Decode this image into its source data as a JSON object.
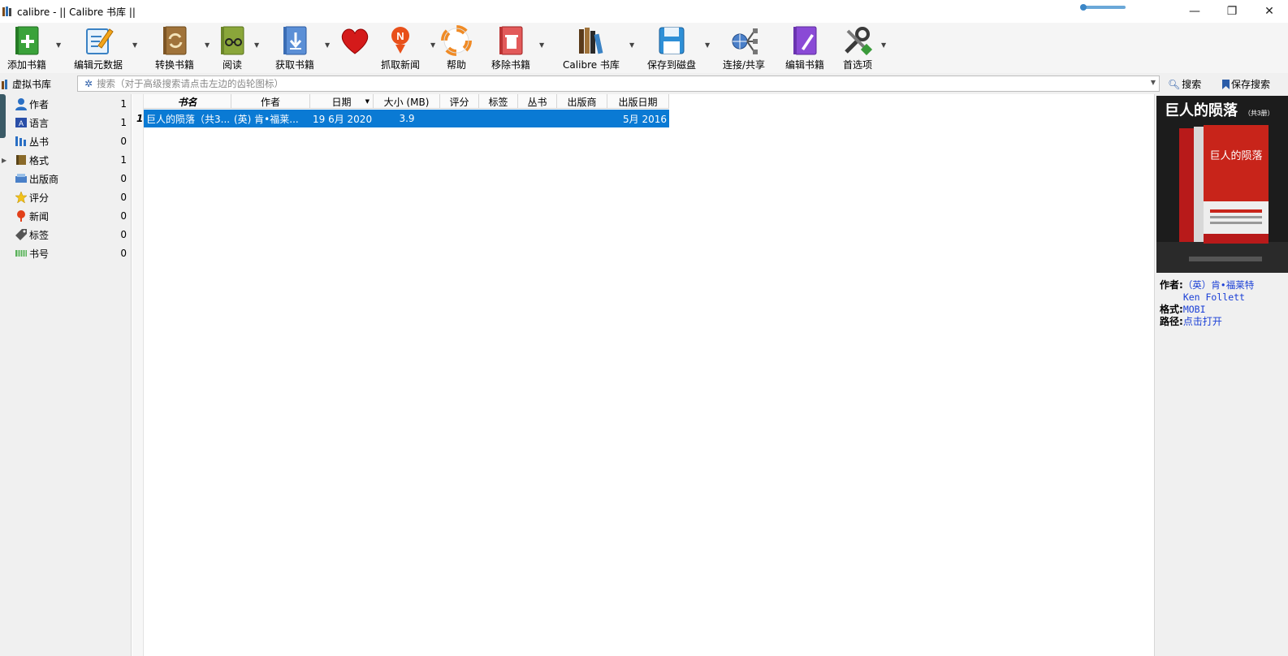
{
  "window": {
    "title": "calibre - || Calibre 书库 ||",
    "minimize": "—",
    "maximize": "❐",
    "close": "✕"
  },
  "toolbar": {
    "buttons": [
      {
        "label": "添加书籍",
        "icon": "add-book-icon"
      },
      {
        "label": "编辑元数据",
        "icon": "edit-metadata-icon"
      },
      {
        "label": "转换书籍",
        "icon": "convert-book-icon"
      },
      {
        "label": "阅读",
        "icon": "read-book-icon"
      },
      {
        "label": "",
        "icon": "heart-icon"
      },
      {
        "label": "获取书籍",
        "icon": "get-books-icon"
      },
      {
        "label": "抓取新闻",
        "icon": "fetch-news-icon"
      },
      {
        "label": "帮助",
        "icon": "help-lifebuoy-icon"
      },
      {
        "label": "移除书籍",
        "icon": "remove-book-icon"
      },
      {
        "label": "Calibre 书库",
        "icon": "library-icon"
      },
      {
        "label": "保存到磁盘",
        "icon": "save-disk-icon"
      },
      {
        "label": "连接/共享",
        "icon": "connect-share-icon"
      },
      {
        "label": "编辑书籍",
        "icon": "edit-book-icon"
      },
      {
        "label": "首选项",
        "icon": "preferences-icon"
      }
    ]
  },
  "searchbar": {
    "virtual_library": "虚拟书库",
    "placeholder": "搜索（对于高级搜索请点击左边的齿轮图标）",
    "search_button": "搜索",
    "save_search_button": "保存搜索"
  },
  "sidebar": {
    "items": [
      {
        "label": "作者",
        "count": "1",
        "icon": "person-icon",
        "expandable": false
      },
      {
        "label": "语言",
        "count": "1",
        "icon": "language-book-icon",
        "expandable": false
      },
      {
        "label": "丛书",
        "count": "0",
        "icon": "series-icon",
        "expandable": false
      },
      {
        "label": "格式",
        "count": "1",
        "icon": "format-book-icon",
        "expandable": true
      },
      {
        "label": "出版商",
        "count": "0",
        "icon": "publisher-icon",
        "expandable": false
      },
      {
        "label": "评分",
        "count": "0",
        "icon": "star-icon",
        "expandable": false
      },
      {
        "label": "新闻",
        "count": "0",
        "icon": "news-pin-icon",
        "expandable": false
      },
      {
        "label": "标签",
        "count": "0",
        "icon": "tag-icon",
        "expandable": false
      },
      {
        "label": "书号",
        "count": "0",
        "icon": "barcode-icon",
        "expandable": false
      }
    ]
  },
  "table": {
    "columns": [
      "书名",
      "作者",
      "日期",
      "大小 (MB)",
      "评分",
      "标签",
      "丛书",
      "出版商",
      "出版日期"
    ],
    "rows": [
      [
        "巨人的陨落（共3...",
        "(英) 肯•福莱...",
        "19 6月 2020",
        "3.9",
        "",
        "",
        "",
        "",
        "5月 2016"
      ]
    ],
    "row_marker": "1"
  },
  "book_details": {
    "cover_title": "巨人的陨落",
    "cover_subtitle": "（共3册）",
    "author_key": "作者:",
    "author_value": "（英）肯•福莱特 Ken Follett",
    "format_key": "格式:",
    "format_value": "MOBI",
    "path_key": "路径:",
    "path_value": "点击打开"
  },
  "colors": {
    "selection": "#0a7ad4",
    "link": "#1a3fd6",
    "toolbar_bg": "#f5f5f5"
  }
}
